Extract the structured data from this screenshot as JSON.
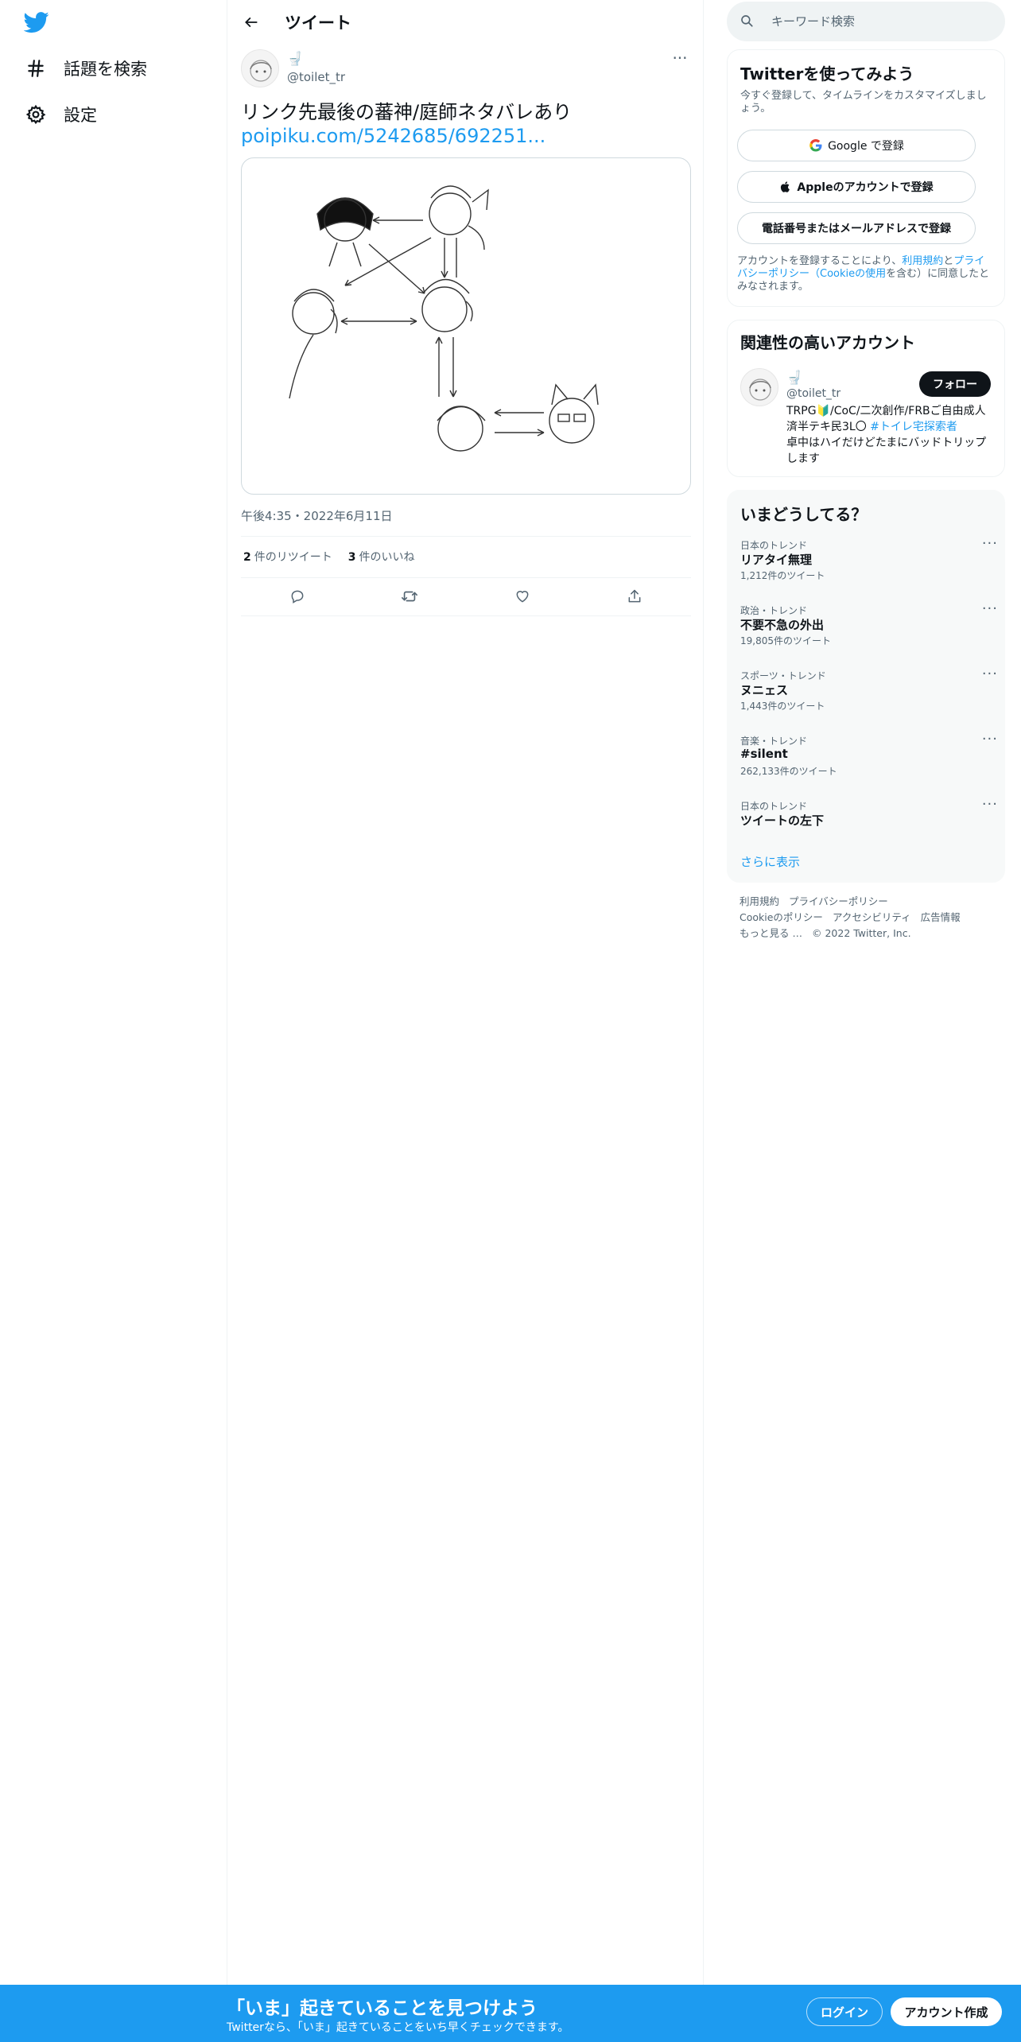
{
  "colors": {
    "brand": "#1d9bf0",
    "text": "#0f1419",
    "muted": "#536471",
    "bottom_bar": "#1d9bf0"
  },
  "nav": {
    "logo_icon": "twitter-bird-icon",
    "items": [
      {
        "label": "話題を検索",
        "icon": "hashtag-icon"
      },
      {
        "label": "設定",
        "icon": "gear-icon"
      }
    ]
  },
  "header": {
    "title": "ツイート"
  },
  "tweet": {
    "author_name": "🚽",
    "author_handle": "@toilet_tr",
    "text": "リンク先最後の蕃神/庭師ネタバレあり",
    "link": "poipiku.com/5242685/692251...",
    "timestamp": "午後4:35・2022年6月11日",
    "retweets": {
      "count": "2",
      "label": "件のリツイート"
    },
    "likes": {
      "count": "3",
      "label": "件のいいね"
    },
    "media_alt": "character relationship sketch"
  },
  "search": {
    "placeholder": "キーワード検索"
  },
  "signup_card": {
    "title": "Twitterを使ってみよう",
    "subtitle": "今すぐ登録して、タイムラインをカスタマイズしましょう。",
    "google": "Google で登録",
    "apple": "Appleのアカウントで登録",
    "phone": "電話番号またはメールアドレスで登録",
    "legal_prefix": "アカウントを登録することにより、",
    "legal_terms": "利用規約",
    "legal_and": "と",
    "legal_privacy": "プライバシーポリシー",
    "legal_cookie": "（Cookieの使用",
    "legal_suffix": "を含む）に同意したとみなされます。"
  },
  "related": {
    "title": "関連性の高いアカウント",
    "name": "🚽",
    "handle": "@toilet_tr",
    "follow": "フォロー",
    "bio": "TRPG🔰/CoC/二次創作/FRBご自由成人済半テキ民3L〇 ",
    "bio_tag": "#トイレ宅探索者",
    "bio_tail": "卓中はハイだけどたまにバッドトリップします"
  },
  "trends": {
    "title": "いまどうしてる？",
    "items": [
      {
        "context": "日本のトレンド",
        "name": "リアタイ無理",
        "count": "1,212件のツイート"
      },
      {
        "context": "政治・トレンド",
        "name": "不要不急の外出",
        "count": "19,805件のツイート"
      },
      {
        "context": "スポーツ・トレンド",
        "name": "ヌニェス",
        "count": "1,443件のツイート"
      },
      {
        "context": "音楽・トレンド",
        "name": "#silent",
        "count": "262,133件のツイート"
      },
      {
        "context": "日本のトレンド",
        "name": "ツイートの左下",
        "count": ""
      }
    ],
    "show_more": "さらに表示"
  },
  "footer": {
    "links": [
      "利用規約",
      "プライバシーポリシー",
      "Cookieのポリシー",
      "アクセシビリティ",
      "広告情報",
      "もっと見る …"
    ],
    "copyright": "© 2022 Twitter, Inc."
  },
  "bottom_bar": {
    "title": "「いま」起きていることを見つけよう",
    "subtitle": "Twitterなら、「いま」起きていることをいち早くチェックできます。",
    "login": "ログイン",
    "signup": "アカウント作成"
  }
}
